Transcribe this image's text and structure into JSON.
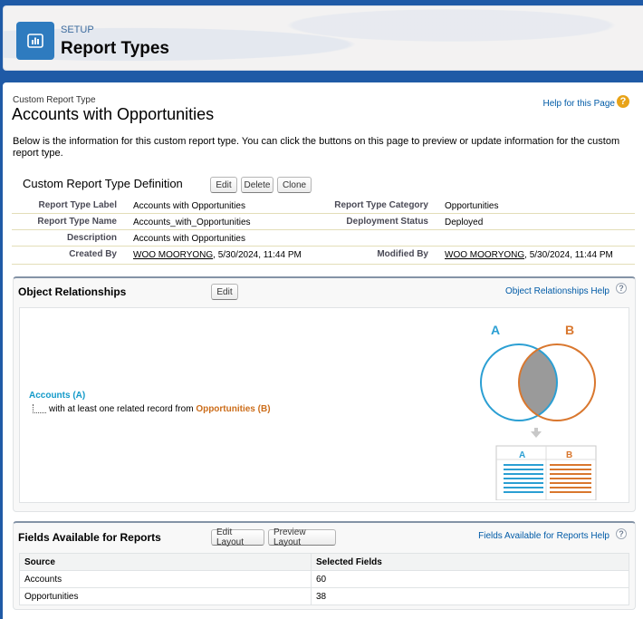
{
  "header": {
    "eyebrow": "SETUP",
    "title": "Report Types",
    "icon": "report-chart-icon"
  },
  "page": {
    "eyebrow": "Custom Report Type",
    "title": "Accounts with Opportunities",
    "help_link": "Help for this Page",
    "intro": "Below is the information for this custom report type. You can click the buttons on this page to preview or update information for the custom report type."
  },
  "definition": {
    "heading": "Custom Report Type Definition",
    "buttons": {
      "edit": "Edit",
      "delete": "Delete",
      "clone": "Clone"
    },
    "labels": {
      "type_label": "Report Type Label",
      "type_name": "Report Type Name",
      "description": "Description",
      "created_by": "Created By",
      "category": "Report Type Category",
      "status": "Deployment Status",
      "modified_by": "Modified By"
    },
    "values": {
      "type_label": "Accounts with Opportunities",
      "type_name": "Accounts_with_Opportunities",
      "description": "Accounts with Opportunities",
      "created_by_user": "WOO MOORYONG",
      "created_by_date": ", 5/30/2024, 11:44 PM",
      "category": "Opportunities",
      "status": "Deployed",
      "modified_by_user": "WOO MOORYONG",
      "modified_by_date": ", 5/30/2024, 11:44 PM"
    }
  },
  "relationships": {
    "title": "Object Relationships",
    "edit_button": "Edit",
    "help_link": "Object Relationships Help",
    "object_a": "Accounts (A)",
    "object_b_prefix": "with at least one related record from ",
    "object_b": "Opportunities (B)",
    "diagram": {
      "label_a": "A",
      "label_b": "B",
      "color_a": "#2b9fd3",
      "color_b": "#d9772e"
    }
  },
  "fields": {
    "title": "Fields Available for Reports",
    "edit_layout_button": "Edit Layout",
    "preview_layout_button": "Preview Layout",
    "help_link": "Fields Available for Reports Help",
    "columns": [
      "Source",
      "Selected Fields"
    ],
    "rows": [
      {
        "source": "Accounts",
        "count": "60"
      },
      {
        "source": "Opportunities",
        "count": "38"
      }
    ]
  }
}
